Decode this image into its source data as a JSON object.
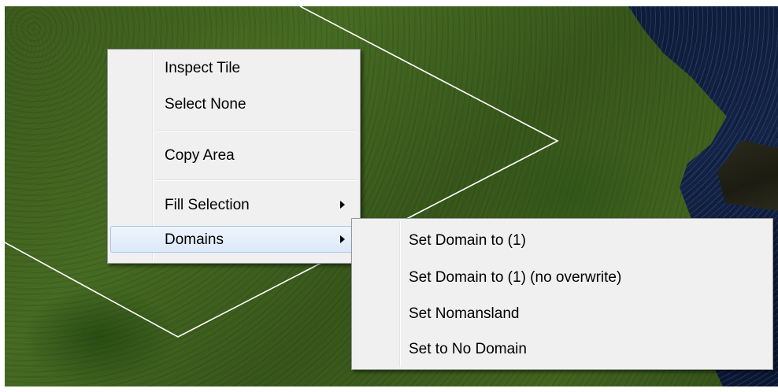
{
  "context_menu": {
    "items": [
      {
        "label": "Inspect Tile"
      },
      {
        "label": "Select None"
      },
      {
        "label": "Copy Area"
      },
      {
        "label": "Fill Selection",
        "has_submenu": true
      },
      {
        "label": "Domains",
        "has_submenu": true,
        "highlighted": true
      }
    ]
  },
  "domains_submenu": {
    "items": [
      {
        "label": "Set Domain to (1)"
      },
      {
        "label": "Set Domain to (1) (no overwrite)"
      },
      {
        "label": "Set Nomansland"
      },
      {
        "label": "Set to No Domain"
      }
    ]
  },
  "colors": {
    "grass": "#3f6320",
    "water": "#132447",
    "selection_outline": "#ffffff",
    "menu_background": "#f0f0f0",
    "menu_highlight": "#dce9f9"
  }
}
